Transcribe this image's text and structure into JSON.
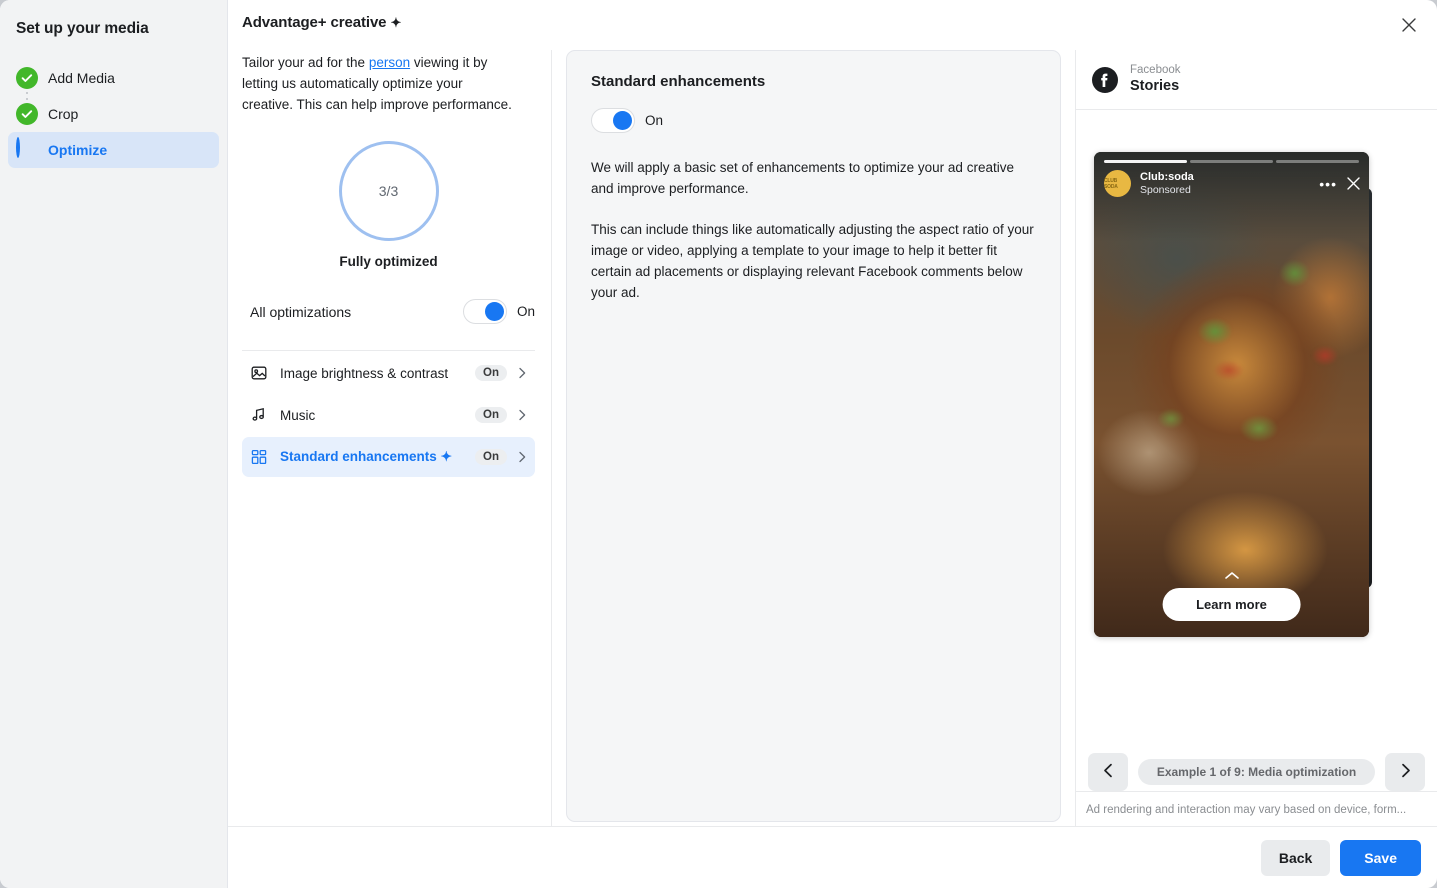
{
  "sidebar": {
    "title": "Set up your media",
    "items": [
      {
        "label": "Add Media",
        "state": "complete",
        "icon": "check-circle-icon"
      },
      {
        "label": "Crop",
        "state": "complete",
        "icon": "check-circle-icon"
      },
      {
        "label": "Optimize",
        "state": "active",
        "icon": "half-circle-icon"
      }
    ]
  },
  "header": {
    "title": "Advantage+ creative",
    "sparkle": "✦",
    "close_icon": "close-icon"
  },
  "optimize_panel": {
    "lead_before": "Tailor your ad for the ",
    "lead_link": "person",
    "lead_after": " viewing it by letting us automatically optimize your creative. This can help improve performance.",
    "ring_value": "3/3",
    "ring_caption": "Fully optimized",
    "ring_color": "#9ec0f0",
    "all_optimizations_label": "All optimizations",
    "all_optimizations_state": "On",
    "items": [
      {
        "label": "Image brightness & contrast",
        "state": "On",
        "icon": "image-icon",
        "selected": false,
        "sparkle": ""
      },
      {
        "label": "Music",
        "state": "On",
        "icon": "music-note-icon",
        "selected": false,
        "sparkle": ""
      },
      {
        "label": "Standard enhancements",
        "state": "On",
        "icon": "template-grid-icon",
        "selected": true,
        "sparkle": "✦"
      }
    ]
  },
  "detail": {
    "title": "Standard enhancements",
    "toggle_state": "On",
    "paragraph_1": "We will apply a basic set of enhancements to optimize your ad creative and improve performance.",
    "paragraph_2": "This can include things like automatically adjusting the aspect ratio of your image or video, applying a template to your image to help it better fit certain ad placements or displaying relevant Facebook comments below your ad."
  },
  "preview": {
    "platform": "Facebook",
    "placement": "Stories",
    "facebook_icon": "facebook-icon",
    "story": {
      "brand": "Club:soda",
      "sponsored": "Sponsored",
      "avatar_text": "CLUB SODA",
      "more_icon": "more-dots-icon",
      "close_icon": "close-icon",
      "cta": "Learn more",
      "progress_segments": 3,
      "progress_filled": 1
    },
    "nav": {
      "prev_icon": "chevron-left-icon",
      "next_icon": "chevron-right-icon",
      "caption": "Example 1 of 9: Media optimization"
    },
    "disclaimer": "Ad rendering and interaction may vary based on device, form..."
  },
  "footer": {
    "back_label": "Back",
    "save_label": "Save"
  },
  "colors": {
    "accent": "#1877f2",
    "success": "#42b72a",
    "ring": "#9ec0f0",
    "selected_row": "#e7f0fd"
  }
}
